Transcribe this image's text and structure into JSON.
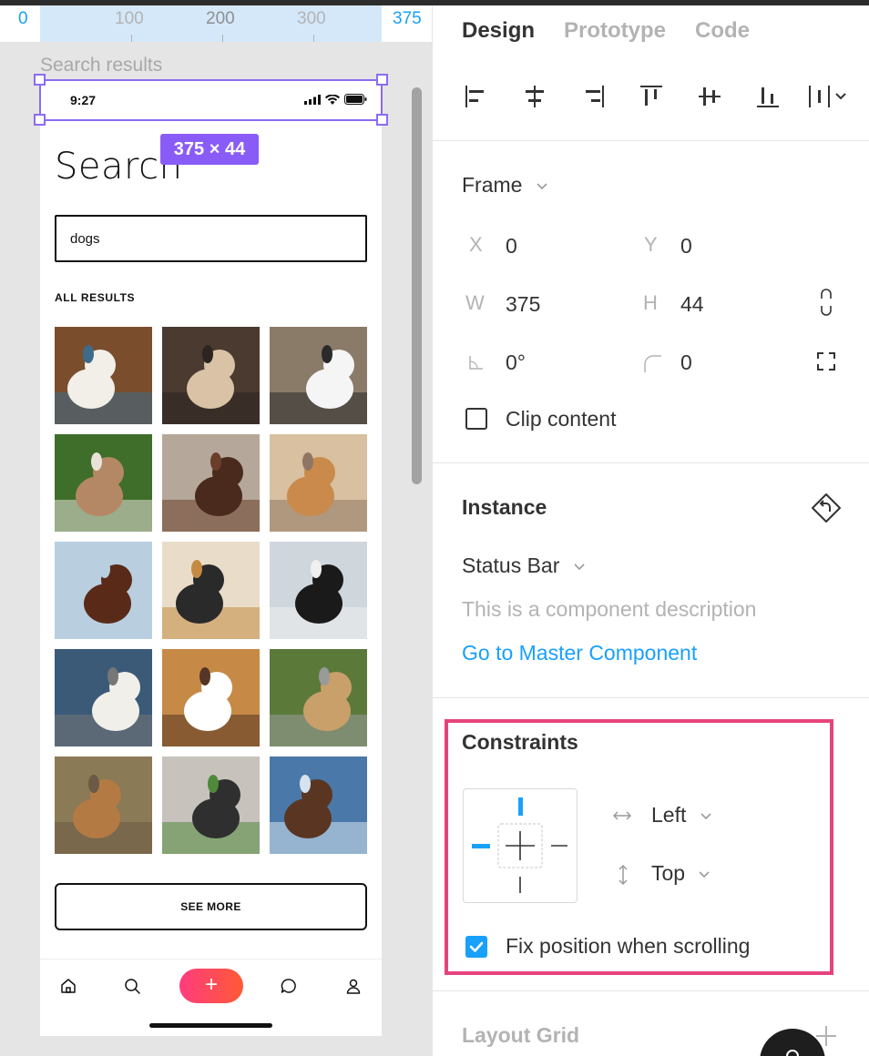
{
  "canvas": {
    "ruler": {
      "marks": [
        "0",
        "100",
        "200",
        "300",
        "375"
      ]
    },
    "frame_label": "Search results",
    "selection_size": "375 × 44"
  },
  "phone": {
    "status_time": "9:27",
    "title": "Search",
    "search_value": "dogs",
    "results_heading": "ALL RESULTS",
    "see_more": "SEE MORE",
    "plus_glyph": "+",
    "photo_colors": [
      [
        "#7a4e2d",
        "#f2efe9",
        "#3d6b8a"
      ],
      [
        "#4a3a30",
        "#d9c2a6",
        "#2b2420"
      ],
      [
        "#8a7a68",
        "#f5f5f5",
        "#2a2a2a"
      ],
      [
        "#3f6e2a",
        "#b58865",
        "#e8e2d8"
      ],
      [
        "#b5a89a",
        "#4a2a1c",
        "#6a3e2a"
      ],
      [
        "#d8c0a0",
        "#c98a4c",
        "#8f7664"
      ],
      [
        "#b9cfe0",
        "#5a2a18",
        "#b9cfe0"
      ],
      [
        "#e9ddc9",
        "#2a2a2a",
        "#c48a42"
      ],
      [
        "#cfd6dc",
        "#1a1a1a",
        "#f0f0f0"
      ],
      [
        "#3a5a78",
        "#f1efe9",
        "#777777"
      ],
      [
        "#c68a46",
        "#ffffff",
        "#553525"
      ],
      [
        "#5b7a3a",
        "#c9a06a",
        "#9a9a9a"
      ],
      [
        "#8a7a55",
        "#b47a44",
        "#6b5a45"
      ],
      [
        "#c7c2bc",
        "#2f2f2f",
        "#4e8a3a"
      ],
      [
        "#4a78a8",
        "#5a3622",
        "#d6e3ee"
      ]
    ]
  },
  "panel": {
    "tabs": [
      "Design",
      "Prototype",
      "Code"
    ],
    "frame": {
      "title": "Frame",
      "x_label": "X",
      "x_value": "0",
      "y_label": "Y",
      "y_value": "0",
      "w_label": "W",
      "w_value": "375",
      "h_label": "H",
      "h_value": "44",
      "rotation_value": "0°",
      "radius_value": "0",
      "clip_content": "Clip content",
      "clip_checked": false
    },
    "instance": {
      "title": "Instance",
      "component_name": "Status Bar",
      "description": "This is a component description",
      "master_link": "Go to Master Component"
    },
    "constraints": {
      "title": "Constraints",
      "horizontal": "Left",
      "vertical": "Top",
      "fix_position": "Fix position when scrolling",
      "fix_checked": true
    },
    "layout_grid": {
      "title": "Layout Grid"
    }
  },
  "colors": {
    "accent": "#18a0fb",
    "selection": "#8a5cf7",
    "highlight": "#e6437c",
    "primary_gradient": [
      "#ff3c7e",
      "#ff5a36"
    ]
  }
}
